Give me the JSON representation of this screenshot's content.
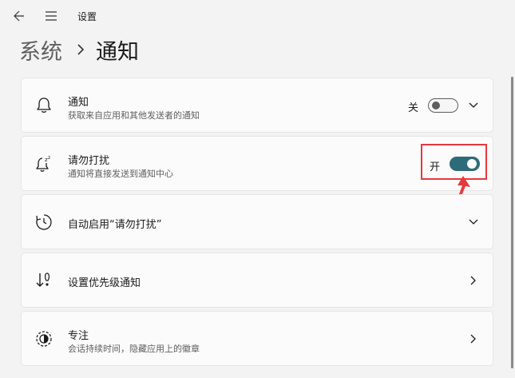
{
  "window": {
    "title": "设置"
  },
  "breadcrumb": {
    "parent": "系统",
    "current": "通知"
  },
  "cards": [
    {
      "title": "通知",
      "subtitle": "获取来自应用和其他发送者的通知",
      "icon": "bell-icon",
      "toggle_label": "关",
      "toggle_state": "off",
      "action": "chevron-down-icon"
    },
    {
      "title": "请勿打扰",
      "subtitle": "通知将直接发送到通知中心",
      "icon": "bell-sleep-icon",
      "toggle_label": "开",
      "toggle_state": "on",
      "highlighted": true
    },
    {
      "title": "自动启用“请勿打扰”",
      "icon": "clock-icon",
      "action": "chevron-down-icon"
    },
    {
      "title": "设置优先级通知",
      "icon": "priority-icon",
      "action": "chevron-right-icon"
    },
    {
      "title": "专注",
      "subtitle": "会话持续时间，隐藏应用上的徽章",
      "icon": "focus-icon",
      "action": "chevron-right-icon"
    }
  ],
  "colors": {
    "toggle_on": "#2e6a7a",
    "highlight": "#e8383d",
    "background": "#f3f3f3",
    "card": "#fbfbfb"
  }
}
